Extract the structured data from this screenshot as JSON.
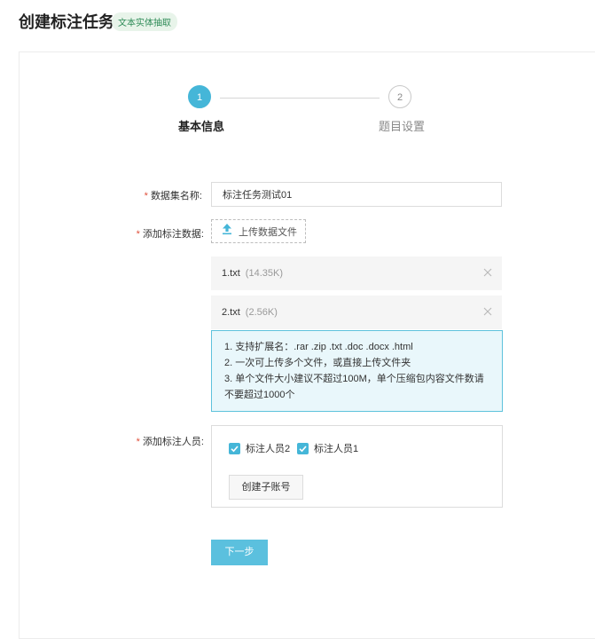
{
  "page": {
    "title": "创建标注任务",
    "task_type_badge": "文本实体抽取"
  },
  "steps": [
    {
      "number": "1",
      "label": "基本信息",
      "state": "active"
    },
    {
      "number": "2",
      "label": "题目设置",
      "state": "pending"
    }
  ],
  "form": {
    "dataset_name": {
      "required_mark": "*",
      "label": "数据集名称:",
      "value": "标注任务测试01"
    },
    "add_data": {
      "required_mark": "*",
      "label": "添加标注数据:",
      "upload_label": "上传数据文件",
      "upload_icon": "upload-icon",
      "files": [
        {
          "name": "1.txt",
          "size": "(14.35K)"
        },
        {
          "name": "2.txt",
          "size": "(2.56K)"
        }
      ],
      "tips": [
        "1. 支持扩展名：.rar .zip .txt .doc .docx .html",
        "2. 一次可上传多个文件，或直接上传文件夹",
        "3. 单个文件大小建议不超过100M，单个压缩包内容文件数请不要超过1000个"
      ]
    },
    "annotators": {
      "required_mark": "*",
      "label": "添加标注人员:",
      "members": [
        {
          "name": "标注人员2",
          "checked": true
        },
        {
          "name": "标注人员1",
          "checked": true
        }
      ],
      "create_sub_account_label": "创建子账号"
    }
  },
  "next_button_label": "下一步",
  "colors": {
    "accent": "#45b6d8",
    "required": "#e0503c",
    "info_bg": "#e9f7fb",
    "info_border": "#5ec2dc"
  }
}
